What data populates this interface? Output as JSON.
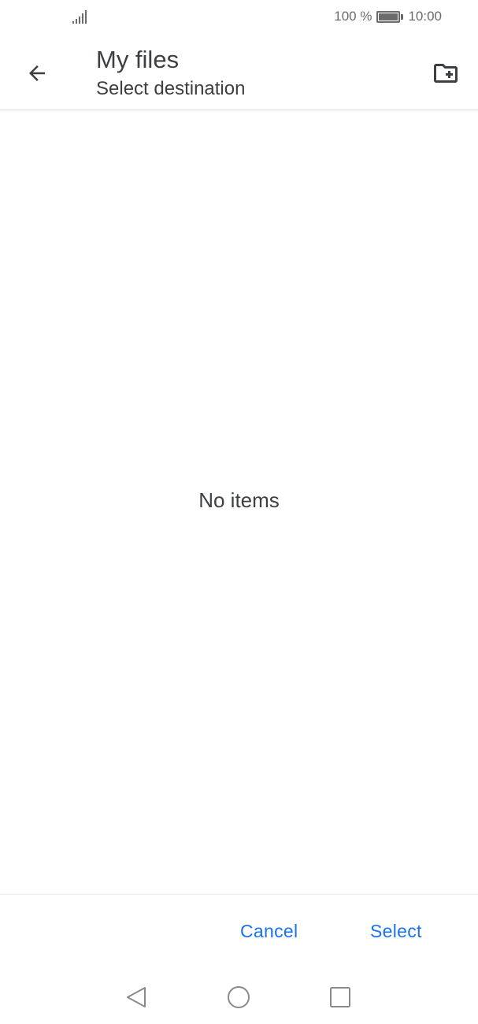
{
  "status_bar": {
    "battery_text": "100 %",
    "time": "10:00",
    "signal_icon": "signal-icon",
    "battery_icon": "battery-full-icon"
  },
  "header": {
    "title": "My files",
    "subtitle": "Select destination",
    "back_icon": "arrow-left-icon",
    "new_folder_icon": "create-new-folder-icon"
  },
  "content": {
    "empty_message": "No items"
  },
  "actions": {
    "cancel_label": "Cancel",
    "select_label": "Select"
  },
  "nav_bar": {
    "back_icon": "triangle-back-icon",
    "home_icon": "circle-home-icon",
    "recent_icon": "square-recent-icon"
  },
  "colors": {
    "accent": "#1a73e8",
    "text_primary": "#3c4043",
    "status_gray": "#6b6b6b"
  }
}
